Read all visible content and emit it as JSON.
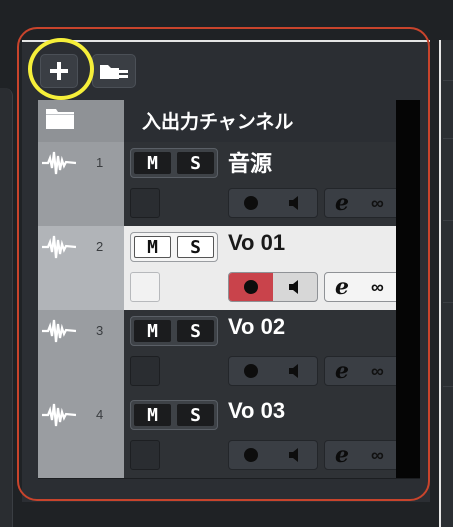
{
  "toolbar": {
    "add_icon": "plus-icon",
    "folder_icon": "folder-menu-icon"
  },
  "folder": {
    "name": "入出力チャンネル",
    "icon": "folder-icon"
  },
  "tracks": [
    {
      "number": "1",
      "name": "音源",
      "mute": "M",
      "solo": "S",
      "selected": false
    },
    {
      "number": "2",
      "name": "Vo 01",
      "mute": "M",
      "solo": "S",
      "selected": true
    },
    {
      "number": "3",
      "name": "Vo 02",
      "mute": "M",
      "solo": "S",
      "selected": false
    },
    {
      "number": "4",
      "name": "Vo 03",
      "mute": "M",
      "solo": "S",
      "selected": false
    }
  ],
  "icons": {
    "track": "audio-waveform-icon",
    "record": "record-dot-icon",
    "monitor": "speaker-icon",
    "edit": "edit-e-icon",
    "link": "infinity-icon"
  },
  "colors": {
    "selected_record": "#c9434b",
    "annotation_rect": "#c8442c",
    "annotation_circle": "#f6ef3a"
  }
}
